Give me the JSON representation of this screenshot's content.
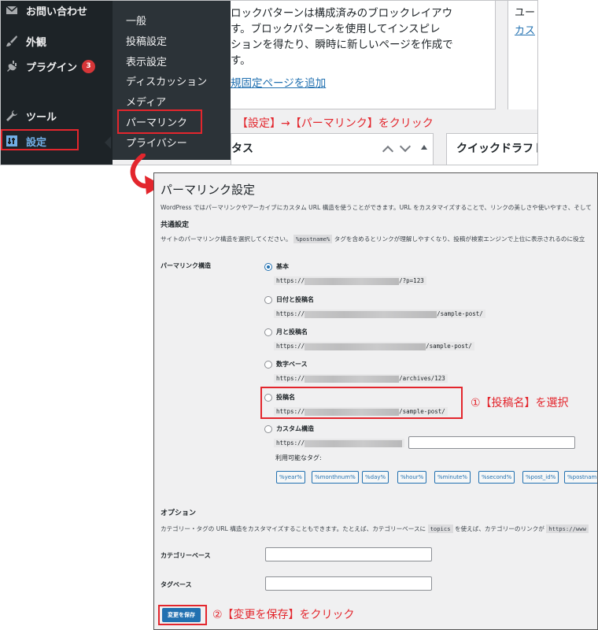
{
  "sidebar": {
    "items": [
      {
        "label": "お問い合わせ",
        "icon": "mail-icon"
      },
      {
        "label": "外観",
        "icon": "brush-icon"
      },
      {
        "label": "プラグイン",
        "icon": "plugin-icon",
        "badge": "3"
      },
      {
        "label": "ツール",
        "icon": "wrench-icon"
      },
      {
        "label": "設定",
        "icon": "settings-icon"
      }
    ]
  },
  "submenu": {
    "items": [
      "一般",
      "投稿設定",
      "表示設定",
      "ディスカッション",
      "メディア",
      "パーマリンク",
      "プライバシー"
    ]
  },
  "top_content": {
    "block_lines": [
      "ロックパターンは構成済みのブロックレイアウ",
      "す。ブロックパターンを使用してインスピレ",
      "ションを得たり、瞬時に新しいページを作成で",
      "す。"
    ],
    "add_page_link": "規固定ページを追加",
    "right_text": "ユー",
    "right_link": "カス",
    "postbox_title": "タス",
    "quick_draft": "クイックドラフト"
  },
  "annotations": {
    "step_top": "【設定】→【パーマリンク】をクリック",
    "step1": "①【投稿名】を選択",
    "step2": "②【変更を保存】をクリック",
    "color": "#e3262d"
  },
  "permalink": {
    "title": "パーマリンク設定",
    "description": "WordPress ではパーマリンクやアーカイブにカスタム URL 構造を使うことができます。URL をカスタマイズすることで、リンクの美しさや使いやすさ、そして",
    "common_heading": "共通設定",
    "common_desc_before": "サイトのパーマリンク構造を選択してください。",
    "common_desc_tag": "%postname%",
    "common_desc_after": "タグを含めるとリンクが理解しやすくなり、投稿が検索エンジンで上位に表示されるのに役立",
    "structure_label": "パーマリンク構造",
    "options": [
      {
        "label": "基本",
        "url_prefix": "https://",
        "url_suffix": "/?p=123",
        "checked": true
      },
      {
        "label": "日付と投稿名",
        "url_prefix": "https://",
        "url_suffix": "/sample-post/",
        "checked": false
      },
      {
        "label": "月と投稿名",
        "url_prefix": "https://",
        "url_suffix": "/sample-post/",
        "checked": false
      },
      {
        "label": "数字ベース",
        "url_prefix": "https://",
        "url_suffix": "/archives/123",
        "checked": false
      },
      {
        "label": "投稿名",
        "url_prefix": "https://",
        "url_suffix": "/sample-post/",
        "checked": false
      },
      {
        "label": "カスタム構造",
        "url_prefix": "https://",
        "url_suffix": "",
        "checked": false
      }
    ],
    "available_tags_label": "利用可能なタグ:",
    "tags": [
      "%year%",
      "%monthnum%",
      "%day%",
      "%hour%",
      "%minute%",
      "%second%",
      "%post_id%",
      "%postnam"
    ],
    "option_heading": "オプション",
    "option_desc_before": "カテゴリー・タグの URL 構造をカスタマイズすることもできます。たとえば、カテゴリーベースに",
    "option_desc_tag": "topics",
    "option_desc_after": "を使えば、カテゴリーのリンクが",
    "option_desc_tag2": "https://www",
    "category_base_label": "カテゴリーベース",
    "tag_base_label": "タグベース",
    "save_label": "変更を保存"
  }
}
